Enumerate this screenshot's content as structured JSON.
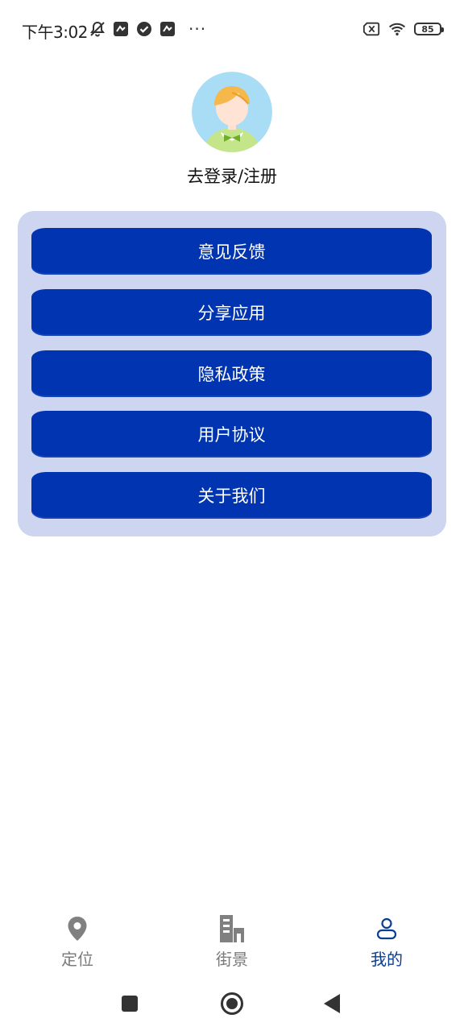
{
  "status_bar": {
    "time": "下午3:02",
    "more": "···",
    "battery": "85",
    "icons": [
      "bell-off-icon",
      "app-notification-icon",
      "check-circle-icon",
      "app-notification-icon",
      "sim-off-icon",
      "wifi-icon"
    ]
  },
  "profile": {
    "avatar_icon": "user-avatar",
    "login_text": "去登录/注册"
  },
  "menu": {
    "items": [
      {
        "label": "意见反馈"
      },
      {
        "label": "分享应用"
      },
      {
        "label": "隐私政策"
      },
      {
        "label": "用户协议"
      },
      {
        "label": "关于我们"
      }
    ]
  },
  "bottom_nav": {
    "items": [
      {
        "label": "定位",
        "icon": "location-pin-icon",
        "active": false
      },
      {
        "label": "街景",
        "icon": "street-view-icon",
        "active": false
      },
      {
        "label": "我的",
        "icon": "person-icon",
        "active": true
      }
    ]
  },
  "system_nav": {
    "buttons": [
      "recent-apps-icon",
      "home-icon",
      "back-icon"
    ]
  },
  "colors": {
    "accent": "#0034b0",
    "card_bg": "#cdd5f0",
    "active_nav": "#0b3d91",
    "inactive_nav": "#7a7a7a"
  }
}
